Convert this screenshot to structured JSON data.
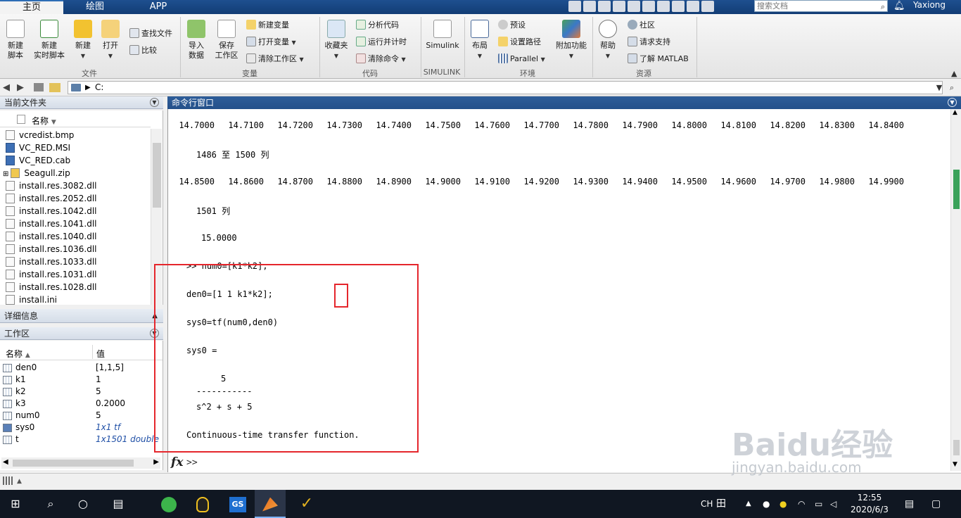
{
  "tabs": [
    "主页",
    "绘图",
    "APP"
  ],
  "search": {
    "placeholder": "搜索文档"
  },
  "user": {
    "name": "Yaxiong"
  },
  "ribbon": {
    "file": {
      "new_script": [
        "新建",
        "脚本"
      ],
      "new_live": [
        "新建",
        "实时脚本"
      ],
      "new": "新建",
      "open": "打开",
      "find_files": "查找文件",
      "compare": "比较",
      "group": "文件"
    },
    "variable": {
      "import": [
        "导入",
        "数据"
      ],
      "save_ws": [
        "保存",
        "工作区"
      ],
      "new_var": "新建变量",
      "open_var": "打开变量",
      "clear_ws": "清除工作区",
      "group": "变量"
    },
    "code": {
      "favorites": "收藏夹",
      "analyze": "分析代码",
      "run_time": "运行并计时",
      "clear_cmd": "清除命令",
      "group": "代码"
    },
    "simulink": {
      "btn": "Simulink",
      "group": "SIMULINK"
    },
    "env": {
      "layout": "布局",
      "prefs": "预设",
      "set_path": "设置路径",
      "parallel": "Parallel",
      "addons": "附加功能",
      "group": "环境"
    },
    "resources": {
      "help": "帮助",
      "community": "社区",
      "support": "请求支持",
      "learn": "了解 MATLAB",
      "group": "资源"
    }
  },
  "address": {
    "path": "C:"
  },
  "current_folder": {
    "title": "当前文件夹",
    "col_name": "名称",
    "files": [
      "vcredist.bmp",
      "VC_RED.MSI",
      "VC_RED.cab",
      "Seagull.zip",
      "install.res.3082.dll",
      "install.res.2052.dll",
      "install.res.1042.dll",
      "install.res.1041.dll",
      "install.res.1040.dll",
      "install.res.1036.dll",
      "install.res.1033.dll",
      "install.res.1031.dll",
      "install.res.1028.dll",
      "install.ini"
    ]
  },
  "details": {
    "title": "详细信息"
  },
  "workspace": {
    "title": "工作区",
    "col_name": "名称",
    "col_value": "值",
    "vars": [
      {
        "name": "den0",
        "value": "[1,1,5]"
      },
      {
        "name": "k1",
        "value": "1"
      },
      {
        "name": "k2",
        "value": "5"
      },
      {
        "name": "k3",
        "value": "0.2000"
      },
      {
        "name": "num0",
        "value": "5"
      },
      {
        "name": "sys0",
        "value": "1x1 tf"
      },
      {
        "name": "t",
        "value": "1x1501 double"
      }
    ]
  },
  "command_window": {
    "title": "命令行窗口",
    "row1": [
      "14.7000",
      "14.7100",
      "14.7200",
      "14.7300",
      "14.7400",
      "14.7500",
      "14.7600",
      "14.7700",
      "14.7800",
      "14.7900",
      "14.8000",
      "14.8100",
      "14.8200",
      "14.8300",
      "14.8400"
    ],
    "col_hdr1": "1486 至 1500 列",
    "row2": [
      "14.8500",
      "14.8600",
      "14.8700",
      "14.8800",
      "14.8900",
      "14.9000",
      "14.9100",
      "14.9200",
      "14.9300",
      "14.9400",
      "14.9500",
      "14.9600",
      "14.9700",
      "14.9800",
      "14.9900"
    ],
    "col_hdr2": "1501 列",
    "row3": "15.0000",
    "cmd1": ">> num0=[k1*k2];",
    "cmd2": "den0=[1 1 k1*k2];",
    "cmd3": "sys0=tf(num0,den0)",
    "out_name": "sys0 =",
    "tf_num": "5",
    "tf_bar": "-----------",
    "tf_den": "s^2 + s + 5",
    "tf_desc": "Continuous-time transfer function.",
    "fx": "fx",
    "prompt": ">>"
  },
  "taskbar": {
    "ime": "CH",
    "time": "12:55",
    "date": "2020/6/3"
  },
  "watermark": {
    "logo": "Baidu经验",
    "url": "jingyan.baidu.com"
  }
}
